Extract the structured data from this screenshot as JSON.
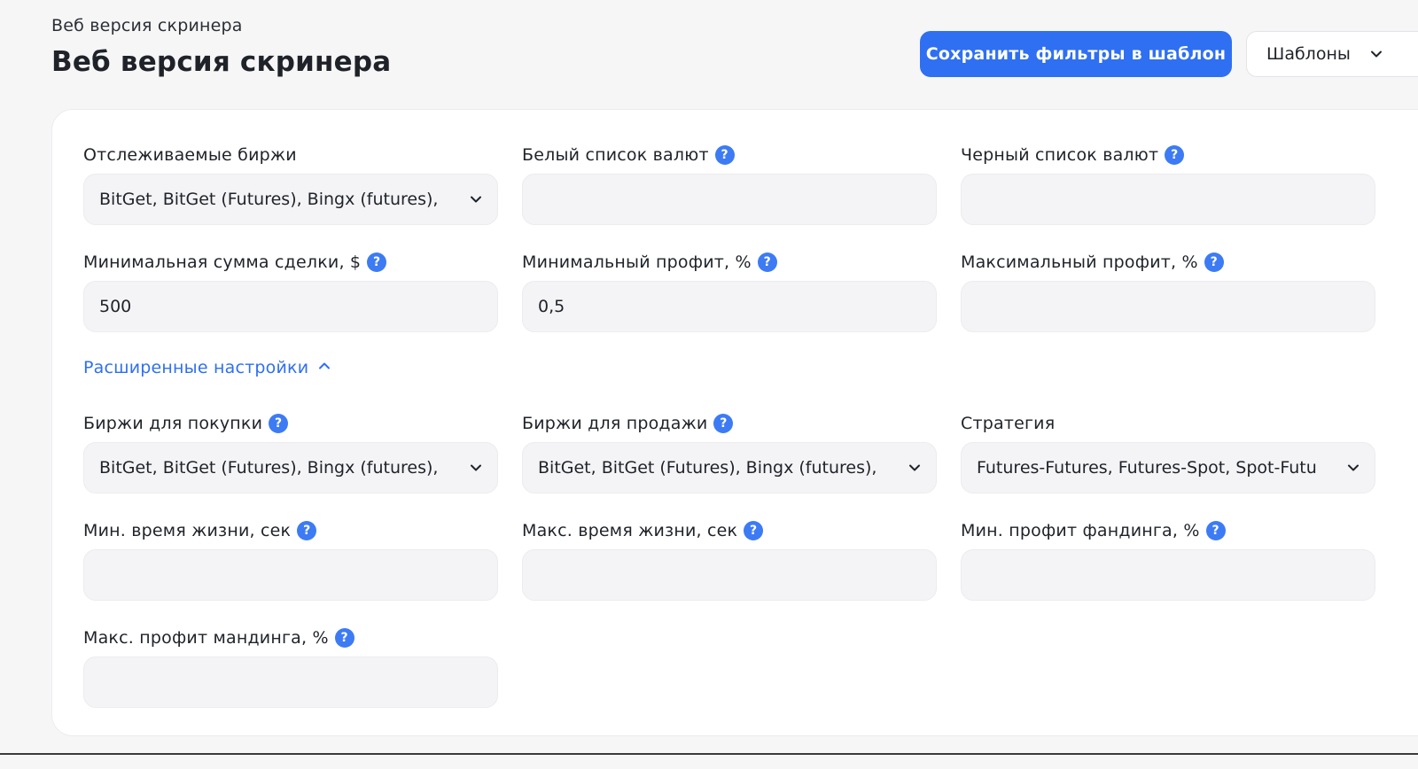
{
  "header": {
    "breadcrumb": "Веб версия скринера",
    "title": "Веб версия скринера",
    "save_button_label": "Сохранить фильтры в шаблон",
    "templates_button_label": "Шаблоны"
  },
  "filters": {
    "tracked_exchanges": {
      "label": "Отслеживаемые биржи",
      "value": "BitGet, BitGet (Futures), Bingx (futures),"
    },
    "whitelist": {
      "label": "Белый список валют",
      "value": ""
    },
    "blacklist": {
      "label": "Черный список валют",
      "value": ""
    },
    "min_deal_amount": {
      "label": "Минимальная сумма сделки, $",
      "value": "500"
    },
    "min_profit": {
      "label": "Минимальный профит, %",
      "value": "0,5"
    },
    "max_profit": {
      "label": "Максимальный профит, %",
      "value": ""
    }
  },
  "advanced": {
    "toggle_label": "Расширенные настройки",
    "buy_exchanges": {
      "label": "Биржи для покупки",
      "value": "BitGet, BitGet (Futures), Bingx (futures),"
    },
    "sell_exchanges": {
      "label": "Биржи для продажи",
      "value": "BitGet, BitGet (Futures), Bingx (futures),"
    },
    "strategy": {
      "label": "Стратегия",
      "value": "Futures-Futures, Futures-Spot, Spot-Futu"
    },
    "min_lifetime": {
      "label": "Мин. время жизни, сек",
      "value": ""
    },
    "max_lifetime": {
      "label": "Макс. время жизни, сек",
      "value": ""
    },
    "min_funding_profit": {
      "label": "Мин. профит фандинга, %",
      "value": ""
    },
    "max_funding_profit": {
      "label": "Макс. профит мандинга, %",
      "value": ""
    }
  },
  "icons": {
    "help": "?",
    "help_icon_name": "question-circle-icon",
    "dropdown_icon_name": "chevron-down-icon",
    "collapse_icon_name": "chevron-up-icon"
  },
  "colors": {
    "accent": "#2f6ff2",
    "help_icon": "#3d7bf4",
    "input_background": "#f4f4f6",
    "page_background": "#f6f6f7"
  }
}
